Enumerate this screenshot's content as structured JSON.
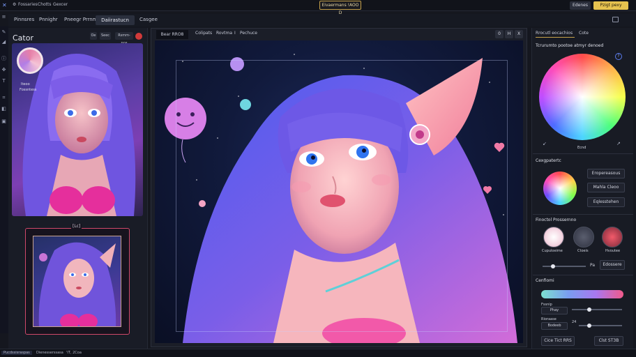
{
  "topbar": {
    "items": [
      "Fossaries",
      "Chotts",
      "Gexcer"
    ],
    "center_title": "Eivaermans !AOO D",
    "right_buttons": [
      "Edenes",
      "Pzigt pexy"
    ]
  },
  "menubar": {
    "items": [
      "Pinnsres",
      "Pnnighr",
      "Pneegr Prrnmn",
      "Daiirastucn",
      "Casgee"
    ],
    "active_index": 3
  },
  "left_panel": {
    "title": "Cator",
    "buttons": [
      "Oe",
      "Seec",
      "Rsmm-nce"
    ],
    "thumb_label_1": "Iteoo",
    "thumb_label_2": "Fossntess",
    "frame_label": "[Lc]"
  },
  "canvas": {
    "tabs": [
      "Bear RRO8",
      "Colipats",
      "Rovtma",
      "I",
      "Pechuce"
    ],
    "buttons": [
      "0",
      "H",
      "X"
    ]
  },
  "right_panel": {
    "tabs": [
      "Rrocutl eocachios",
      "Cote"
    ],
    "wheel_title": "Tcrurumto pootoe atmyr denoed",
    "wheel_label": "Ecnd",
    "palette_title": "Cexgpatertc",
    "palette_buttons": [
      "Eropereasous",
      "Mahla Cleoo",
      "Eqlesstehen"
    ],
    "presets_title": "Finoctol Prossernno",
    "presets": [
      "Cupuloeime",
      "Ctoeis",
      "Hvoutee"
    ],
    "slider_label": "Pa",
    "slider_button": "Edossere",
    "gradient_title": "Cenfiomi",
    "fields": [
      {
        "label": "Fssnip",
        "value": "Phay"
      },
      {
        "label": "Rioraase",
        "value": "Bodeeb"
      }
    ],
    "field_values": [
      "Ck",
      "24"
    ],
    "footer_buttons": [
      "Cice Tict RRS",
      "Clst ST3B"
    ]
  },
  "statusbar": {
    "items": [
      "Pucdssisraspas",
      "Dienesserssasa",
      "'IT, 2Coa"
    ]
  },
  "colors": {
    "accent_gold": "#c6a14a",
    "frame_pink": "#d0486a",
    "panel_bg": "#191c26",
    "canvas_bg": "#0a0f24"
  },
  "icons": [
    "x-logo-icon",
    "gear-icon",
    "layers-icon",
    "pen-icon",
    "brush-icon",
    "text-icon",
    "crop-icon",
    "color-wheel-icon",
    "info-icon",
    "heart-icon"
  ]
}
